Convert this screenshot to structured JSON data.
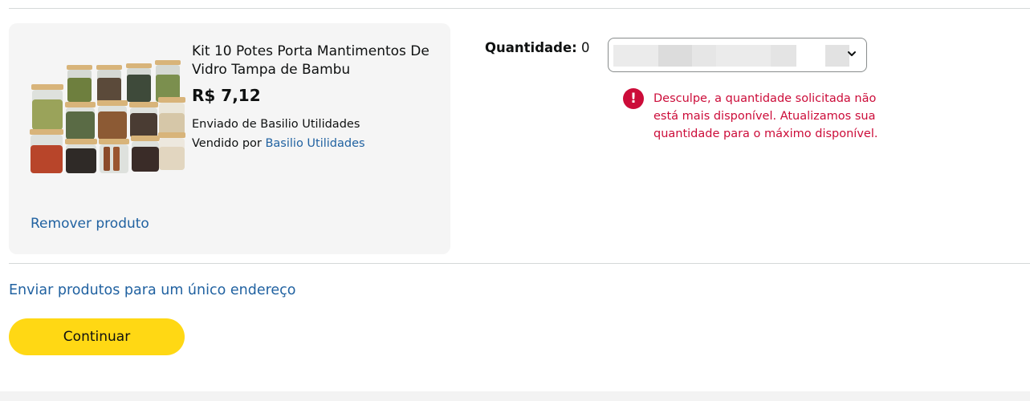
{
  "product": {
    "title": "Kit 10 Potes Porta Mantimentos De Vidro Tampa de Bambu",
    "price": "R$ 7,12",
    "shipped_from": "Enviado de Basilio Utilidades",
    "sold_by_prefix": "Vendido por",
    "seller_name": "Basilio Utilidades",
    "remove_label": "Remover produto",
    "image_icon": "spice-jars-image"
  },
  "quantity": {
    "label": "Quantidade:",
    "value": "0",
    "select_icon": "chevron-down-icon"
  },
  "error": {
    "icon": "!",
    "message": "Desculpe, a quantidade solicitada não está mais disponível. Atualizamos sua quantidade para o máximo disponível."
  },
  "actions": {
    "single_address_label": "Enviar produtos para um único endereço",
    "continue_label": "Continuar"
  },
  "colors": {
    "link": "#2162a1",
    "error": "#cc0c39",
    "button": "#ffd814",
    "card_bg": "#f5f5f5"
  }
}
